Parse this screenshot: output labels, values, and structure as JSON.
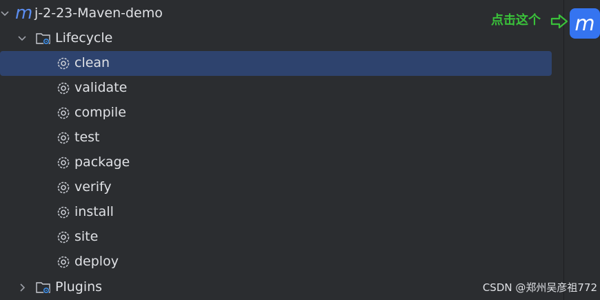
{
  "project": {
    "name": "j-2-23-Maven-demo",
    "icon": "maven-m-icon",
    "icon_glyph": "m"
  },
  "lifecycle": {
    "label": "Lifecycle",
    "items": [
      {
        "label": "clean",
        "selected": true
      },
      {
        "label": "validate"
      },
      {
        "label": "compile"
      },
      {
        "label": "test"
      },
      {
        "label": "package"
      },
      {
        "label": "verify"
      },
      {
        "label": "install"
      },
      {
        "label": "site"
      },
      {
        "label": "deploy"
      }
    ]
  },
  "plugins": {
    "label": "Plugins"
  },
  "toolbar": {
    "maven_button_glyph": "m"
  },
  "annotation": {
    "text": "点击这个"
  },
  "watermark": "CSDN @郑州吴彦祖772",
  "colors": {
    "background": "#2b2d30",
    "selection": "#2e436e",
    "accent": "#3574f0",
    "annotation": "#3ac13a"
  }
}
